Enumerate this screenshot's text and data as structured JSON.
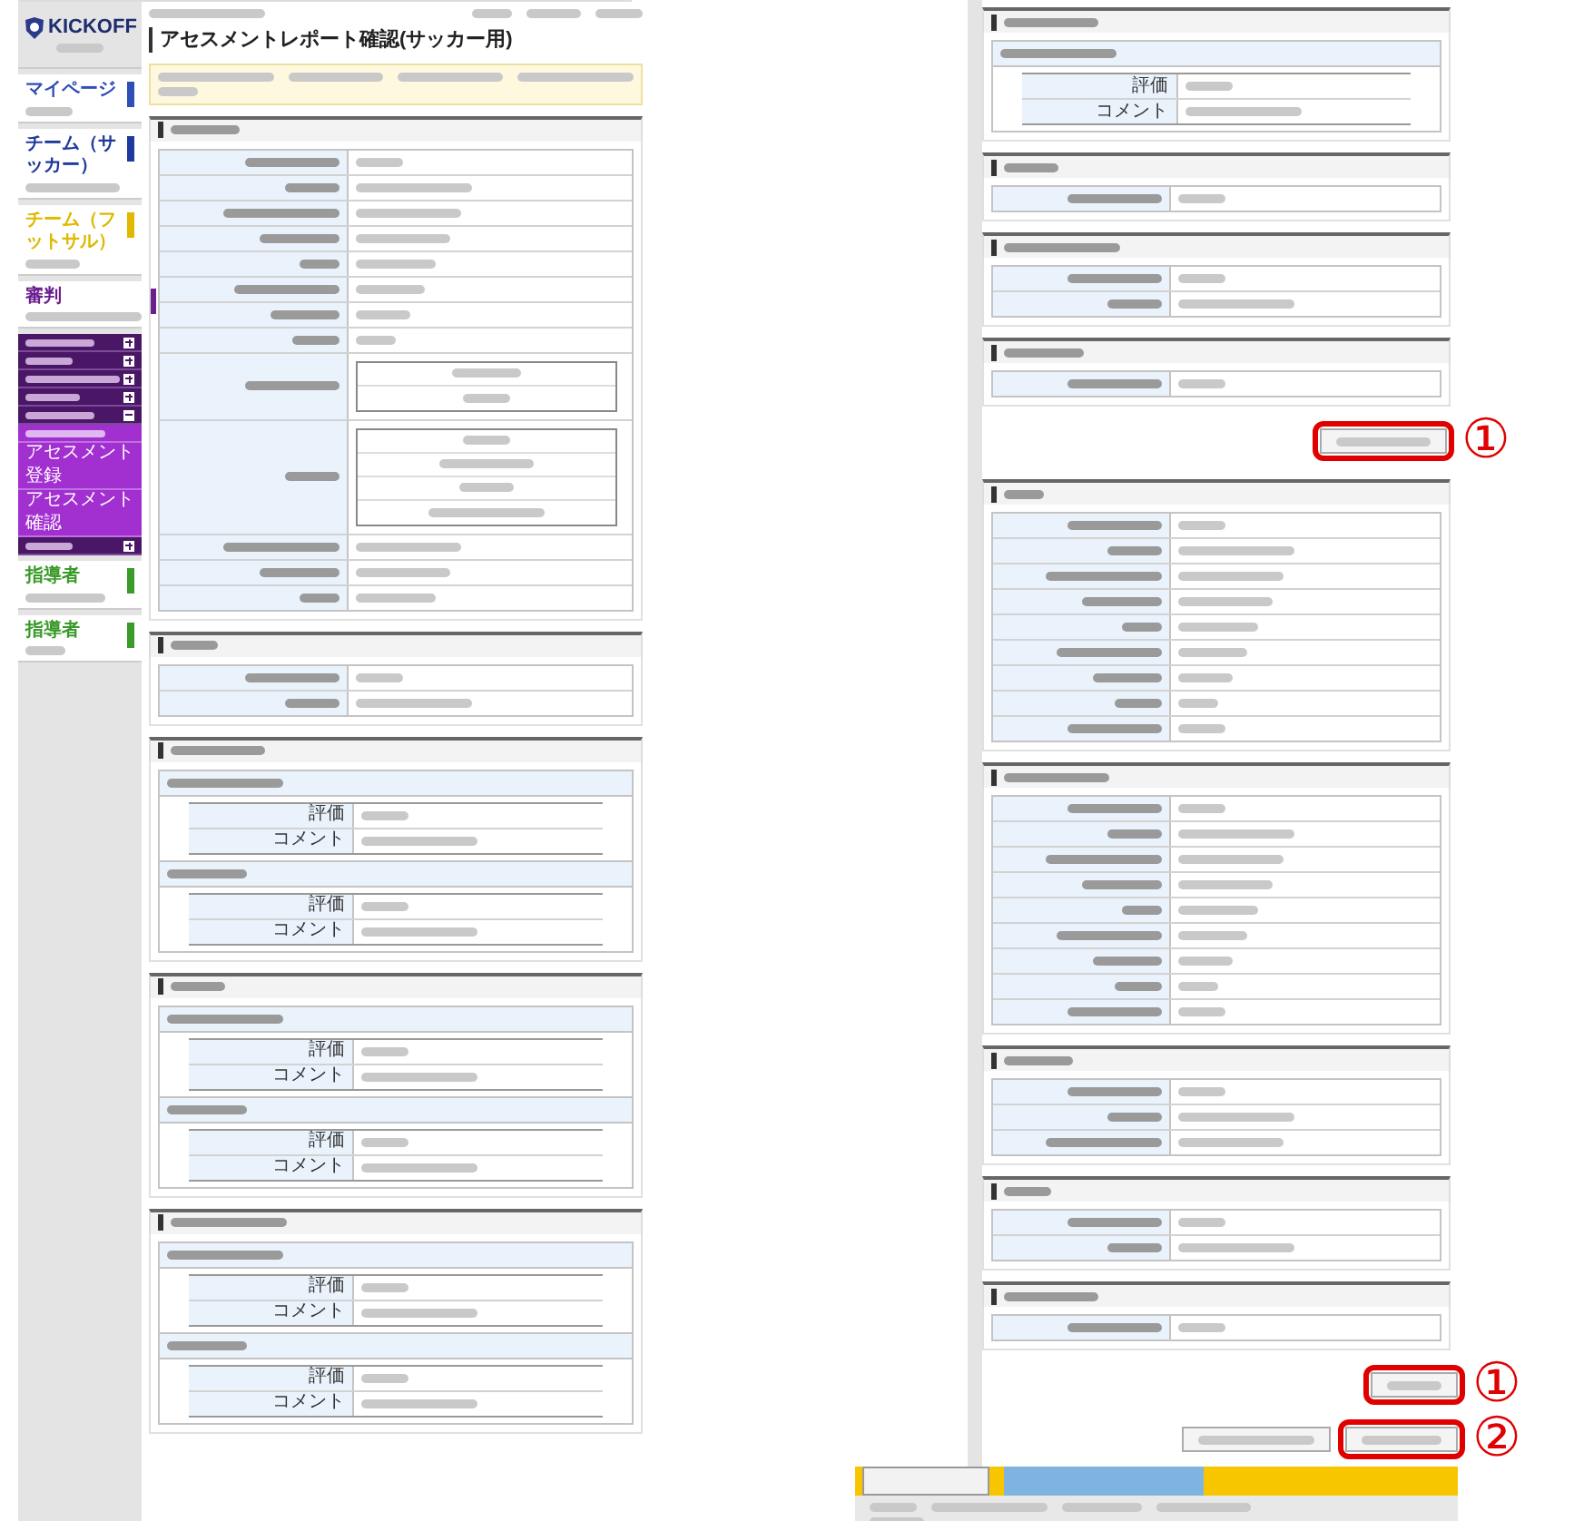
{
  "left_page": {
    "header": {
      "logo": "KICKOFF",
      "title": "アセスメントレポート確認(サッカー用)"
    },
    "sidebar": {
      "cards": [
        {
          "label": "マイページ",
          "color": "#2f4fb5"
        },
        {
          "label": "チーム（サッカー）",
          "color": "#1f3a9e"
        },
        {
          "label": "チーム（フットサル）",
          "color": "#e0b800"
        },
        {
          "label": "審判",
          "color": "#6b1f8f"
        }
      ],
      "menu": [
        {
          "kind": "blurred",
          "expanded": false
        },
        {
          "kind": "blurred",
          "expanded": false
        },
        {
          "kind": "blurred",
          "expanded": false
        },
        {
          "kind": "blurred",
          "expanded": false
        },
        {
          "kind": "blurred",
          "expanded": true,
          "children": [
            {
              "kind": "blurred"
            },
            {
              "kind": "text",
              "label": "アセスメント登録"
            },
            {
              "kind": "text",
              "label": "アセスメント確認"
            }
          ]
        },
        {
          "kind": "blurred",
          "expanded": false
        }
      ],
      "lower_cards": [
        {
          "label": "指導者",
          "color": "#3a9a2a"
        },
        {
          "label": "指導者",
          "color": "#3a9a2a"
        }
      ]
    },
    "sections": [
      {
        "kind": "table",
        "rows": [
          {
            "kind": "blurred"
          },
          {
            "kind": "blurred"
          },
          {
            "kind": "blurred"
          },
          {
            "kind": "blurred"
          },
          {
            "kind": "blurred"
          },
          {
            "kind": "blurred"
          },
          {
            "kind": "blurred"
          },
          {
            "kind": "blurred"
          },
          {
            "kind": "box",
            "lines": [
              {
                "kind": "blurred"
              },
              {
                "kind": "blurred"
              }
            ]
          },
          {
            "kind": "box",
            "lines": [
              {
                "kind": "blurred"
              },
              {
                "kind": "blurred"
              },
              {
                "kind": "blurred"
              },
              {
                "kind": "blurred"
              }
            ]
          },
          {
            "kind": "blurred"
          },
          {
            "kind": "blurred"
          },
          {
            "kind": "blurred"
          }
        ]
      },
      {
        "kind": "table",
        "rows": [
          {
            "kind": "blurred"
          },
          {
            "kind": "blurred"
          }
        ]
      },
      {
        "kind": "questions",
        "questions": [
          {
            "rows": [
              {
                "kind": "labeled",
                "label": "評価"
              },
              {
                "kind": "labeled",
                "label": "コメント"
              }
            ]
          },
          {
            "rows": [
              {
                "kind": "labeled",
                "label": "評価"
              },
              {
                "kind": "labeled",
                "label": "コメント"
              }
            ]
          }
        ]
      },
      {
        "kind": "questions",
        "questions": [
          {
            "rows": [
              {
                "kind": "labeled",
                "label": "評価"
              },
              {
                "kind": "labeled",
                "label": "コメント"
              }
            ]
          },
          {
            "rows": [
              {
                "kind": "labeled",
                "label": "評価"
              },
              {
                "kind": "labeled",
                "label": "コメント"
              }
            ]
          }
        ]
      },
      {
        "kind": "questions",
        "questions": [
          {
            "rows": [
              {
                "kind": "labeled",
                "label": "評価"
              },
              {
                "kind": "labeled",
                "label": "コメント"
              }
            ]
          },
          {
            "rows": [
              {
                "kind": "labeled",
                "label": "評価"
              },
              {
                "kind": "labeled",
                "label": "コメント"
              }
            ]
          }
        ]
      }
    ]
  },
  "right_page": {
    "sections": [
      {
        "kind": "questions",
        "questions": [
          {
            "rows": [
              {
                "kind": "labeled",
                "label": "評価"
              },
              {
                "kind": "labeled",
                "label": "コメント"
              }
            ]
          }
        ]
      },
      {
        "kind": "table",
        "rows": [
          {
            "kind": "blurred"
          }
        ]
      },
      {
        "kind": "table",
        "rows": [
          {
            "kind": "blurred"
          },
          {
            "kind": "blurred"
          }
        ]
      },
      {
        "kind": "table",
        "rows": [
          {
            "kind": "blurred"
          }
        ],
        "button": {
          "highlighted": true,
          "annotation": "①"
        }
      },
      {
        "kind": "table",
        "rows": [
          {
            "kind": "blurred"
          },
          {
            "kind": "blurred"
          },
          {
            "kind": "blurred"
          },
          {
            "kind": "blurred"
          },
          {
            "kind": "blurred"
          },
          {
            "kind": "blurred"
          },
          {
            "kind": "blurred"
          },
          {
            "kind": "blurred"
          },
          {
            "kind": "blurred"
          }
        ]
      },
      {
        "kind": "table",
        "rows": [
          {
            "kind": "blurred"
          },
          {
            "kind": "blurred"
          },
          {
            "kind": "blurred"
          },
          {
            "kind": "blurred"
          },
          {
            "kind": "blurred"
          },
          {
            "kind": "blurred"
          },
          {
            "kind": "blurred"
          },
          {
            "kind": "blurred"
          },
          {
            "kind": "blurred"
          }
        ]
      },
      {
        "kind": "table",
        "rows": [
          {
            "kind": "blurred"
          },
          {
            "kind": "blurred"
          },
          {
            "kind": "blurred"
          }
        ]
      },
      {
        "kind": "table",
        "rows": [
          {
            "kind": "blurred"
          },
          {
            "kind": "blurred"
          }
        ]
      },
      {
        "kind": "table",
        "rows": [
          {
            "kind": "blurred"
          }
        ]
      }
    ],
    "action_rows": [
      {
        "buttons": [
          {
            "highlighted": true,
            "annotation": "①"
          }
        ]
      },
      {
        "buttons": [
          {
            "highlighted": false
          },
          {
            "highlighted": true,
            "annotation": "②"
          }
        ]
      }
    ]
  }
}
